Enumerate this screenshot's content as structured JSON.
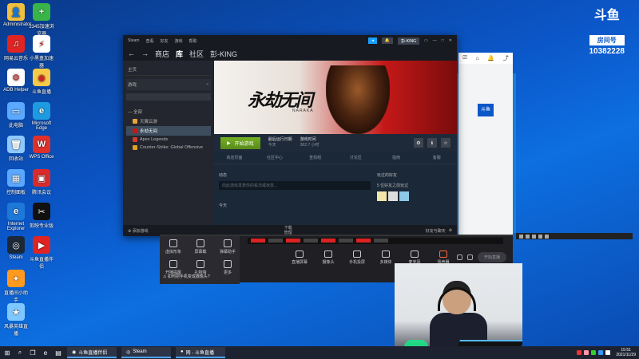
{
  "desktop": {
    "icons": [
      {
        "label": "Administrator",
        "color": "#f0c040",
        "glyph": "👤"
      },
      {
        "label": "2345加速浏览器",
        "color": "#38b449",
        "glyph": "+"
      },
      {
        "label": "网易云音乐",
        "color": "#e02424",
        "glyph": "♫"
      },
      {
        "label": "小黑盒加速器",
        "color": "#ffffff",
        "glyph": "⚡"
      },
      {
        "label": "ADB Helper",
        "color": "#ffffff",
        "glyph": "⚙"
      },
      {
        "label": "斗鱼直播",
        "color": "#f7c948",
        "glyph": "◉"
      },
      {
        "label": "此电脑",
        "color": "#5aa8ff",
        "glyph": "▭"
      },
      {
        "label": "Microsoft Edge",
        "color": "#1e9be0",
        "glyph": "e"
      },
      {
        "label": "回收站",
        "color": "#8fc9ff",
        "glyph": "🗑"
      },
      {
        "label": "WPS Office",
        "color": "#e0302a",
        "glyph": "W"
      },
      {
        "label": "控制面板",
        "color": "#5aa8ff",
        "glyph": "▦"
      },
      {
        "label": "腾讯会议",
        "color": "#d92b2b",
        "glyph": "▣"
      },
      {
        "label": "Internet Explorer",
        "color": "#1e78d8",
        "glyph": "e"
      },
      {
        "label": "剪映专业版",
        "color": "#111111",
        "glyph": "✂"
      },
      {
        "label": "Steam",
        "color": "#1b2838",
        "glyph": "◎"
      },
      {
        "label": "斗鱼直播伴侣",
        "color": "#e02424",
        "glyph": "▶"
      },
      {
        "label": "直播间小助手",
        "color": "#ff9a1f",
        "glyph": "✦"
      },
      {
        "label": "风暴英雄直播",
        "color": "#7ec8ff",
        "glyph": "★"
      }
    ],
    "brand": {
      "logo": "斗鱼",
      "room_label": "房间号",
      "room_number": "10382228"
    }
  },
  "steam": {
    "titlebar": {
      "app": "Steam",
      "menus": [
        "查看",
        "好友",
        "游戏",
        "帮助"
      ],
      "username": "彭-KING"
    },
    "nav": {
      "back": "←",
      "forward": "→",
      "tabs": [
        "商店",
        "库",
        "社区"
      ],
      "user": "彭-KING"
    },
    "sidebar": {
      "home": "主页",
      "category": "游戏",
      "all_label": "— 全部",
      "games": [
        {
          "name": "天翼云游",
          "color": "#e8a33a",
          "selected": false
        },
        {
          "name": "永劫无间",
          "color": "#c51818",
          "selected": true
        },
        {
          "name": "Apex Legends",
          "color": "#d23a2a",
          "selected": false
        },
        {
          "name": "Counter-Strike: Global Offensive",
          "color": "#e0a020",
          "selected": false
        }
      ],
      "add_game": "添加游戏"
    },
    "hero": {
      "title": "永劫无间",
      "subtitle": "NARAKA"
    },
    "playbar": {
      "play": "开始游戏",
      "last_played_label": "最后运行日期",
      "last_played_value": "今天",
      "playtime_label": "游戏时间",
      "playtime_value": "362.7 小时"
    },
    "subtabs": [
      "商店页面",
      "社区中心",
      "查找组",
      "讨论区",
      "指南",
      "客服"
    ],
    "activity": {
      "title": "动态",
      "placeholder": "向此游戏发表你的看法或状态...",
      "today": "今天"
    },
    "friends": {
      "title": "玩过的好友",
      "count_text": "5 位好友之前玩过"
    },
    "bottom": {
      "downloads": "下载",
      "manage": "管理",
      "friends_chat": "好友与聊天"
    }
  },
  "live": {
    "left_items": [
      "虚拟形象",
      "屏幕截",
      "弹幕助手",
      "开播提醒",
      "礼物墙",
      "更多"
    ],
    "warning": "如何把手机变成摄像头?",
    "tools": [
      "直播屏幕",
      "摄像头",
      "手机投屏",
      "多媒体",
      "麦克风",
      "扬声器"
    ],
    "start": "开始直播"
  },
  "taskbar": {
    "apps": [
      "斗鱼直播伴侣",
      "Steam",
      "网 - 斗鱼直播"
    ],
    "time": "15:51",
    "date": "2021/11/29"
  }
}
